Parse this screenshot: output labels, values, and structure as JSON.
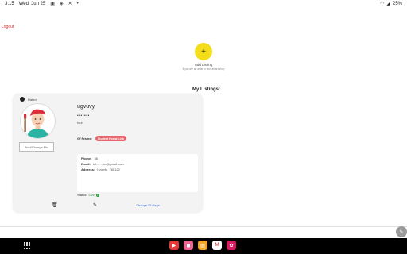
{
  "status_bar": {
    "time": "3:15",
    "date": "Wed, Jun 25",
    "battery": "25%"
  },
  "page": {
    "logout_label": "Logout"
  },
  "add_listing": {
    "plus": "+",
    "title": "Add Listing",
    "subtitle": "If you are an artist or own an art shop"
  },
  "my_listings_label": "My Listings:",
  "card": {
    "rater_label": "Rated",
    "change_pic_label": "Add/Change Pic",
    "username": "ugvuvy",
    "masked": "•••••••",
    "small_text": "tour",
    "gf_label": "Gf Frame:",
    "gf_badge": "Student Portal Link",
    "phone_key": "Phone:",
    "phone_val": "56",
    "email_key": "Email:",
    "email_val": "tcl........ru@gmail.com",
    "address_key": "Address:",
    "address_val": "hvgfvfg, 765122",
    "status_key": "Status:",
    "status_val": "Live",
    "change_gf_label": "Change Gf Page"
  },
  "colors": {
    "accent_yellow": "#f4dd1a",
    "badge_red": "#e8656b",
    "live_green": "#2e9b43",
    "logout_red": "#d32f2f",
    "link_blue": "#3a6fd8"
  },
  "icons": {
    "trash": "trash-icon",
    "edit": "edit-icon",
    "pencil_fab": "pencil-icon"
  }
}
